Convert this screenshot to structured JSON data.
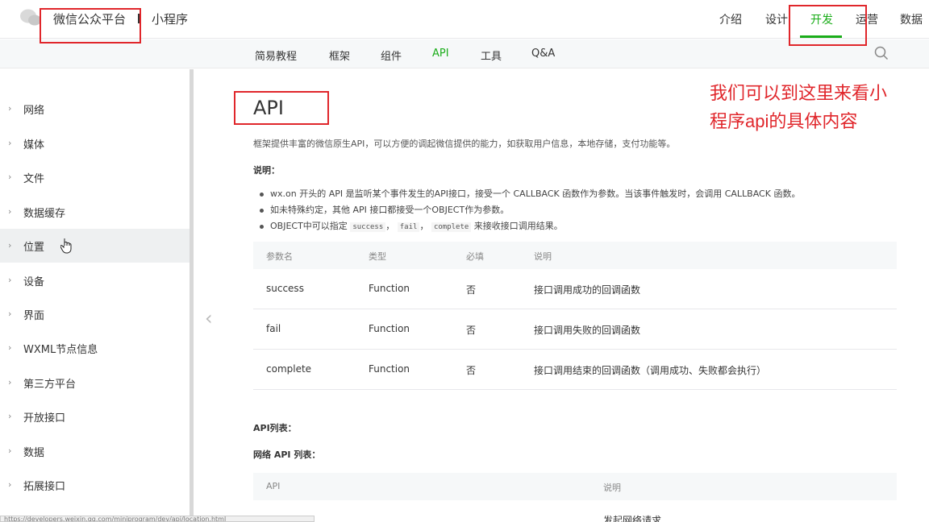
{
  "header": {
    "brand": "微信公众平台",
    "product": "小程序",
    "nav": [
      "介绍",
      "设计",
      "开发",
      "运营",
      "数据"
    ],
    "active_nav": "开发"
  },
  "subnav": {
    "items": [
      "简易教程",
      "框架",
      "组件",
      "API",
      "工具",
      "Q&A"
    ],
    "active": "API"
  },
  "sidebar": {
    "items": [
      "网络",
      "媒体",
      "文件",
      "数据缓存",
      "位置",
      "设备",
      "界面",
      "WXML节点信息",
      "第三方平台",
      "开放接口",
      "数据",
      "拓展接口"
    ],
    "hovered": "位置"
  },
  "main": {
    "title": "API",
    "intro": "框架提供丰富的微信原生API，可以方便的调起微信提供的能力，如获取用户信息，本地存储，支付功能等。",
    "note_heading": "说明：",
    "bullets": {
      "b1": "wx.on 开头的 API 是监听某个事件发生的API接口，接受一个 CALLBACK 函数作为参数。当该事件触发时，会调用 CALLBACK 函数。",
      "b2": "如未特殊约定，其他 API 接口都接受一个OBJECT作为参数。",
      "b3_pre": "OBJECT中可以指定",
      "b3_success": "success",
      "b3_sep1": "，",
      "b3_fail": "fail",
      "b3_sep2": "，",
      "b3_complete": "complete",
      "b3_post": "来接收接口调用结果。"
    },
    "param_table": {
      "headers": [
        "参数名",
        "类型",
        "必填",
        "说明"
      ],
      "rows": [
        [
          "success",
          "Function",
          "否",
          "接口调用成功的回调函数"
        ],
        [
          "fail",
          "Function",
          "否",
          "接口调用失败的回调函数"
        ],
        [
          "complete",
          "Function",
          "否",
          "接口调用结束的回调函数（调用成功、失败都会执行）"
        ]
      ]
    },
    "api_list_heading": "API列表：",
    "net_heading": "网络 API 列表：",
    "api_table": {
      "headers": [
        "API",
        "说明"
      ],
      "first_row_desc": "发起网络请求"
    }
  },
  "annotation": {
    "line1": "我们可以到这里来看小",
    "line2_pre": "程序",
    "line2_bold": "api",
    "line2_post": "的具体内容"
  },
  "status_url": "https://developers.weixin.qq.com/miniprogram/dev/api/location.html",
  "colors": {
    "accent": "#1aad19",
    "annotation": "#e0262b"
  }
}
